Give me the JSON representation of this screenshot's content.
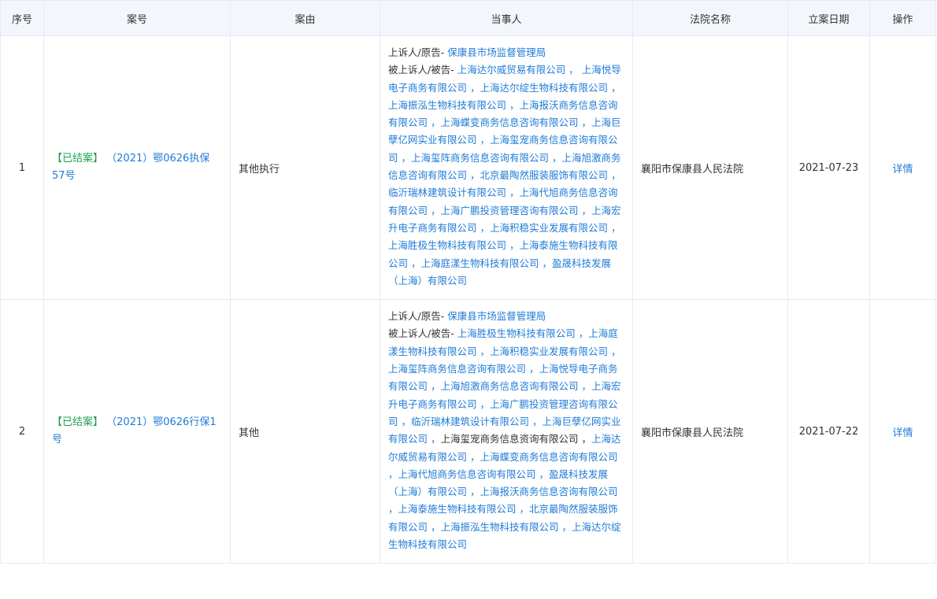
{
  "columns": {
    "index": "序号",
    "case_no": "案号",
    "reason": "案由",
    "parties": "当事人",
    "court": "法院名称",
    "filing_date": "立案日期",
    "action": "操作"
  },
  "rows": [
    {
      "index": "1",
      "status": "【已结案】",
      "case_no": "（2021）鄂0626执保57号",
      "reason": "其他执行",
      "appellant_label": "上诉人/原告-",
      "appellant": "保康县市场监督管理局",
      "appellee_label": "被上诉人/被告-",
      "appellee_lead": "上海达尔威贸易有限公司 ，",
      "appellee_rest": "上海悦导电子商务有限公司 ，上海达尔绽生物科技有限公司 ，上海振泓生物科技有限公司 ，上海报沃商务信息咨询有限公司 ，上海蝶变商务信息咨询有限公司 ，上海巨孽亿网实业有限公司 ，上海玺宠商务信息咨询有限公司 ，上海玺阵商务信息咨询有限公司 ，上海旭激商务信息咨询有限公司 ，北京最陶然服装服饰有限公司 ，临沂瑞林建筑设计有限公司 ，上海代旭商务信息咨询有限公司 ，上海广鹏投资管理咨询有限公司 ，上海宏升电子商务有限公司 ，上海积稳实业发展有限公司 ，上海胜极生物科技有限公司 ，上海泰施生物科技有限公司 ，上海庭漾生物科技有限公司 ，盈晟科技发展（上海）有限公司",
      "court": "襄阳市保康县人民法院",
      "date": "2021-07-23",
      "action": "详情"
    },
    {
      "index": "2",
      "status": "【已结案】",
      "case_no": "（2021）鄂0626行保1号",
      "reason": "其他",
      "appellant_label": "上诉人/原告-",
      "appellant": "保康县市场监督管理局",
      "appellee_label": "被上诉人/被告-",
      "appellee_part1": "上海胜极生物科技有限公司 ，上海庭漾生物科技有限公司 ，上海积稳实业发展有限公司 ，上海玺阵商务信息咨询有限公司 ，上海悦导电子商务有限公司 ，上海旭激商务信息咨询有限公司 ，上海宏升电子商务有限公司 ，上海广鹏投资管理咨询有限公司 ，临沂瑞林建筑设计有限公司 ，上海巨孽亿网实业有限公司 ，",
      "appellee_plain": "上海玺宠商务信息资询有限公司 ，",
      "appellee_part2": "上海达尔威贸易有限公司 ，上海蝶变商务信息咨询有限公司 ，上海代旭商务信息咨询有限公司 ，盈晟科技发展（上海）有限公司 ，上海报沃商务信息咨询有限公司 ，上海泰施生物科技有限公司 ，北京最陶然服装服饰有限公司 ，上海振泓生物科技有限公司 ，上海达尔绽生物科技有限公司",
      "court": "襄阳市保康县人民法院",
      "date": "2021-07-22",
      "action": "详情"
    }
  ],
  "colors": {
    "header_bg": "#f3f7fc",
    "border": "#e6ebf2",
    "status_green": "#1c9f4e",
    "link_blue": "#1f7bd6"
  }
}
